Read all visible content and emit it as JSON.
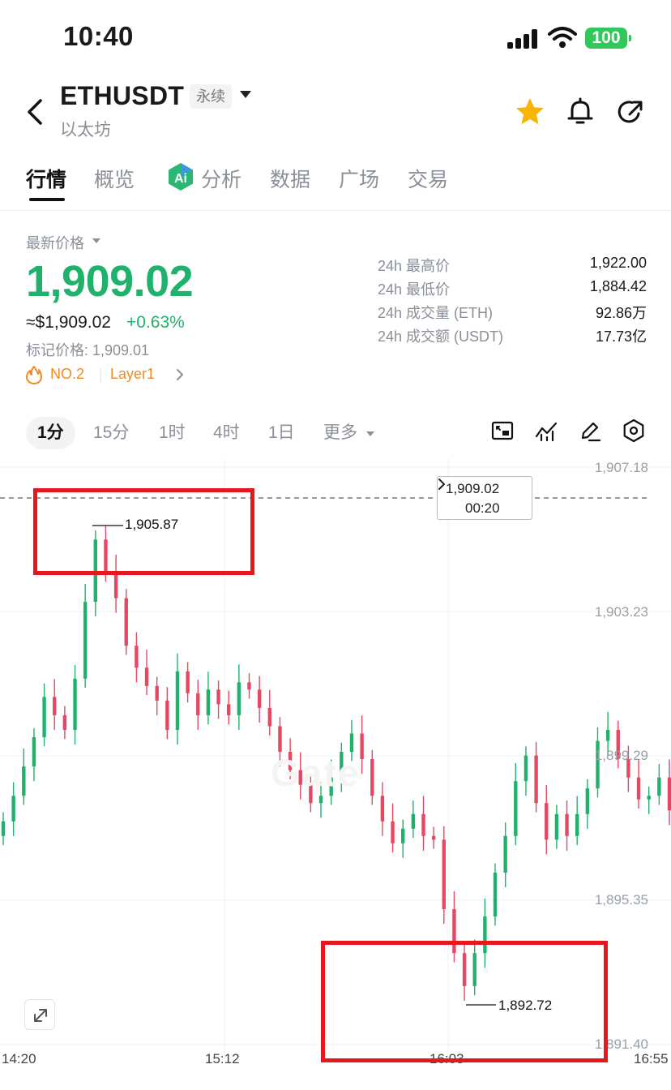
{
  "status_bar": {
    "time": "10:40",
    "battery": "100"
  },
  "header": {
    "symbol": "ETHUSDT",
    "contract_type": "永续",
    "name": "以太坊"
  },
  "tabs": [
    {
      "label": "行情",
      "active": true
    },
    {
      "label": "概览"
    },
    {
      "label": "分析"
    },
    {
      "label": "数据"
    },
    {
      "label": "广场"
    },
    {
      "label": "交易"
    }
  ],
  "price": {
    "latest_label": "最新价格",
    "last": "1,909.02",
    "usd": "≈$1,909.02",
    "change": "+0.63%",
    "mark_price": "标记价格: 1,909.01",
    "rank": "NO.2",
    "category": "Layer1"
  },
  "stats": [
    {
      "label": "24h 最高价",
      "value": "1,922.00"
    },
    {
      "label": "24h 最低价",
      "value": "1,884.42"
    },
    {
      "label": "24h 成交量 (ETH)",
      "value": "92.86万"
    },
    {
      "label": "24h 成交额 (USDT)",
      "value": "17.73亿"
    }
  ],
  "timeframes": [
    "1分",
    "15分",
    "1时",
    "4时",
    "1日",
    "更多"
  ],
  "chart": {
    "y_ticks": [
      "1,907.18",
      "1,903.23",
      "1,899.29",
      "1,895.35",
      "1,891.40"
    ],
    "x_ticks": [
      "14:20",
      "15:12",
      "16:03",
      "16:55"
    ],
    "current_price": "1,909.02",
    "countdown": "00:20",
    "high_label": "1,905.87",
    "low_label": "1,892.72",
    "watermark": "Gate",
    "up_color": "#20b26c",
    "down_color": "#e54863"
  },
  "chart_data": {
    "type": "candlestick",
    "timeframe": "1分",
    "x_ticks": [
      "14:20",
      "15:12",
      "16:03",
      "16:55"
    ],
    "y_ticks": [
      1907.18,
      1903.23,
      1899.29,
      1895.35,
      1891.4
    ],
    "ylim": [
      1891.4,
      1907.18
    ],
    "current_price": 1909.02,
    "period_high": 1905.87,
    "period_low": 1892.72,
    "closes": [
      1897.5,
      1898.2,
      1899.0,
      1899.8,
      1900.9,
      1900.4,
      1900.0,
      1901.4,
      1903.5,
      1905.2,
      1904.3,
      1903.6,
      1902.3,
      1901.7,
      1901.2,
      1900.8,
      1900.0,
      1901.6,
      1901.0,
      1900.4,
      1901.1,
      1900.7,
      1900.4,
      1901.3,
      1901.1,
      1900.6,
      1900.1,
      1899.4,
      1898.9,
      1898.5,
      1898.0,
      1898.2,
      1898.7,
      1899.4,
      1899.9,
      1899.2,
      1898.2,
      1897.5,
      1896.9,
      1897.3,
      1897.7,
      1897.1,
      1897.0,
      1895.1,
      1893.9,
      1893.0,
      1893.9,
      1894.9,
      1896.1,
      1897.1,
      1898.6,
      1899.3,
      1898.0,
      1897.0,
      1897.7,
      1897.1,
      1897.7,
      1898.4,
      1899.7,
      1900.0,
      1899.2,
      1898.7,
      1898.1,
      1898.2,
      1898.7,
      1897.8
    ]
  }
}
